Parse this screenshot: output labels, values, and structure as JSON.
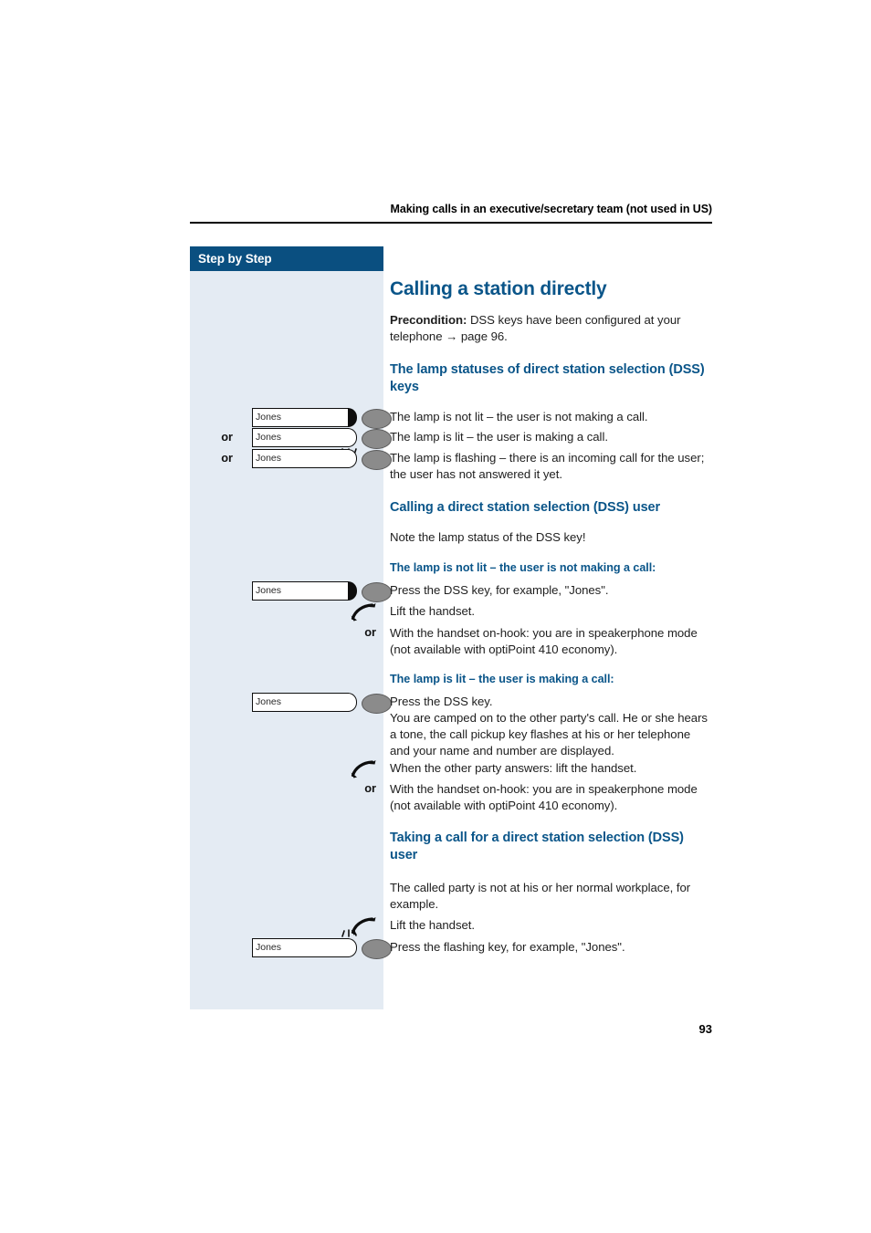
{
  "header": {
    "running_title": "Making calls in an executive/secretary team (not used in US)"
  },
  "sidebar": {
    "title": "Step by Step"
  },
  "page_number": "93",
  "colors": {
    "heading_blue": "#0a5589",
    "sidebar_header_blue": "#0a4f80",
    "sidebar_background": "#e4ebf3",
    "body_text": "#1e1e1e",
    "key_button_grey": "#8b8b8b"
  },
  "content": {
    "section_title": "Calling a station directly",
    "precondition_label": "Precondition:",
    "precondition_text": " DSS keys have been configured at your telephone",
    "precondition_arrow": "→",
    "precondition_page_ref": " page 96.",
    "lamp_statuses_heading": "The lamp statuses of direct station selection (DSS) keys",
    "lamp_status_rows": [
      {
        "or_label": "",
        "key_label": "Jones",
        "lamp_state": "off",
        "text": "The lamp is not lit – the user is not making a call."
      },
      {
        "or_label": "or",
        "key_label": "Jones",
        "lamp_state": "lit",
        "text": "The lamp is lit – the user is making a call."
      },
      {
        "or_label": "or",
        "key_label": "Jones",
        "lamp_state": "flashing",
        "text": "The lamp is flashing – there is an incoming call for the user; the user has not answered it yet."
      }
    ],
    "calling_dss_user_heading": "Calling a direct station selection (DSS) user",
    "calling_dss_user_note": "Note the lamp status of the DSS key!",
    "not_lit_heading": "The lamp is not lit – the user is not making a call:",
    "not_lit_press_key_label": "Jones",
    "not_lit_press_key_text": "Press the DSS key, for example, \"Jones\".",
    "not_lit_lift_handset_text": "Lift the handset.",
    "not_lit_or_label": "or",
    "not_lit_speakerphone_text": "With the handset on-hook: you are in speakerphone mode (not available with optiPoint 410 economy).",
    "is_lit_heading": "The lamp is lit – the user is making a call:",
    "is_lit_press_key_label": "Jones",
    "is_lit_press_key_text": "Press the DSS key.\nYou are camped on to the other party's call. He or she hears a tone, the call pickup key flashes at his or her telephone and your name and number are displayed.",
    "is_lit_answers_text": "When the other party answers: lift the handset.",
    "is_lit_or_label": "or",
    "is_lit_speakerphone_text": "With the handset on-hook: you are in speakerphone mode (not available with optiPoint 410 economy).",
    "taking_call_heading": "Taking a call for a direct station selection (DSS) user",
    "taking_call_intro": "The called party is not at his or her normal workplace, for example.",
    "taking_call_lift_text": "Lift the handset.",
    "taking_call_key_label": "Jones",
    "taking_call_press_text": "Press the flashing key, for example, \"Jones\"."
  },
  "icons": {
    "handset": "lift-handset-icon",
    "dss_key": "dss-key-icon",
    "flash_rays": "flash-rays-icon"
  }
}
